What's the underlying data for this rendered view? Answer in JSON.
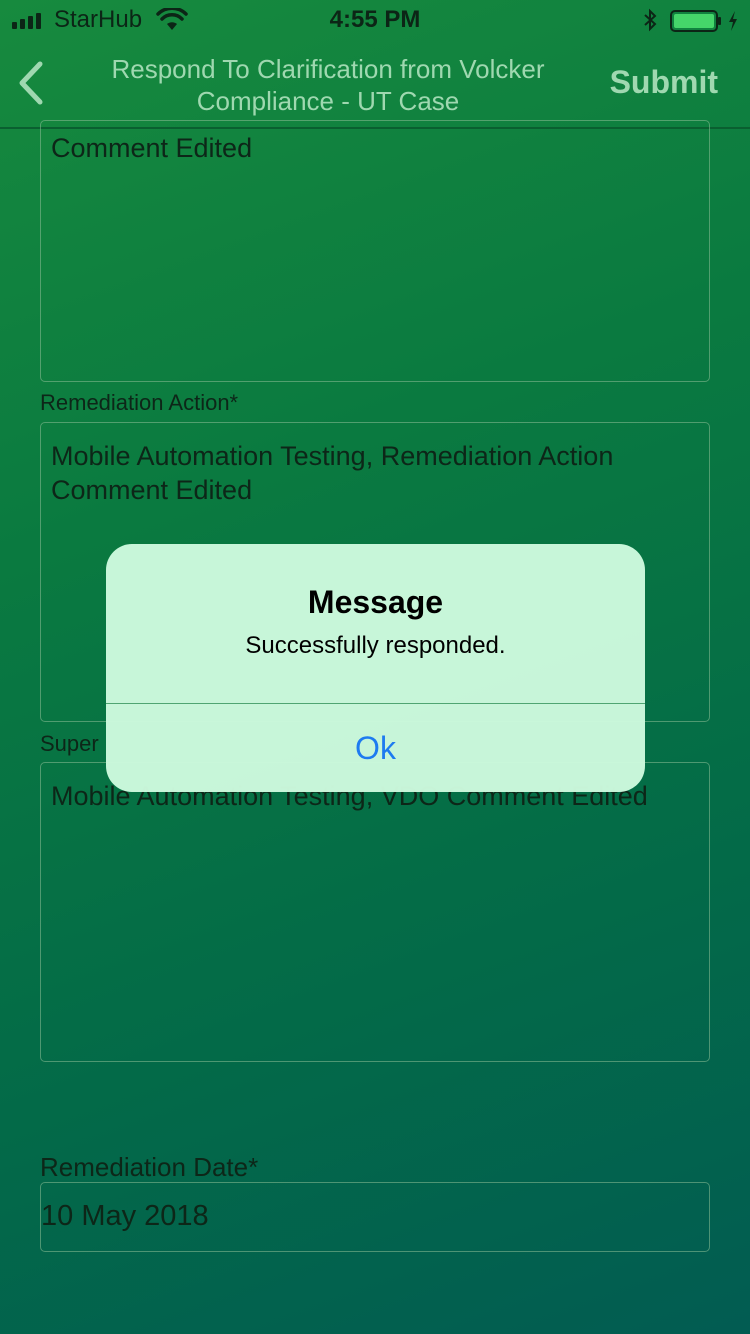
{
  "status_bar": {
    "carrier": "StarHub",
    "time": "4:55 PM"
  },
  "nav": {
    "title": "Respond To Clarification from Volcker Compliance - UT Case",
    "submit_label": "Submit"
  },
  "form": {
    "first_comment": {
      "value": "Comment Edited"
    },
    "remediation_action": {
      "label": "Remediation Action*",
      "value": "Mobile Automation Testing, Remediation Action Comment Edited"
    },
    "supervisor_comment": {
      "label": "Super",
      "value": "Mobile Automation Testing, VDO Comment Edited"
    },
    "remediation_date": {
      "label": "Remediation Date*",
      "value": "10 May 2018"
    }
  },
  "dialog": {
    "title": "Message",
    "message": "Successfully responded.",
    "ok_label": "Ok"
  },
  "colors": {
    "accent_link": "#1e7bf0",
    "nav_text": "#9fd8b0"
  }
}
